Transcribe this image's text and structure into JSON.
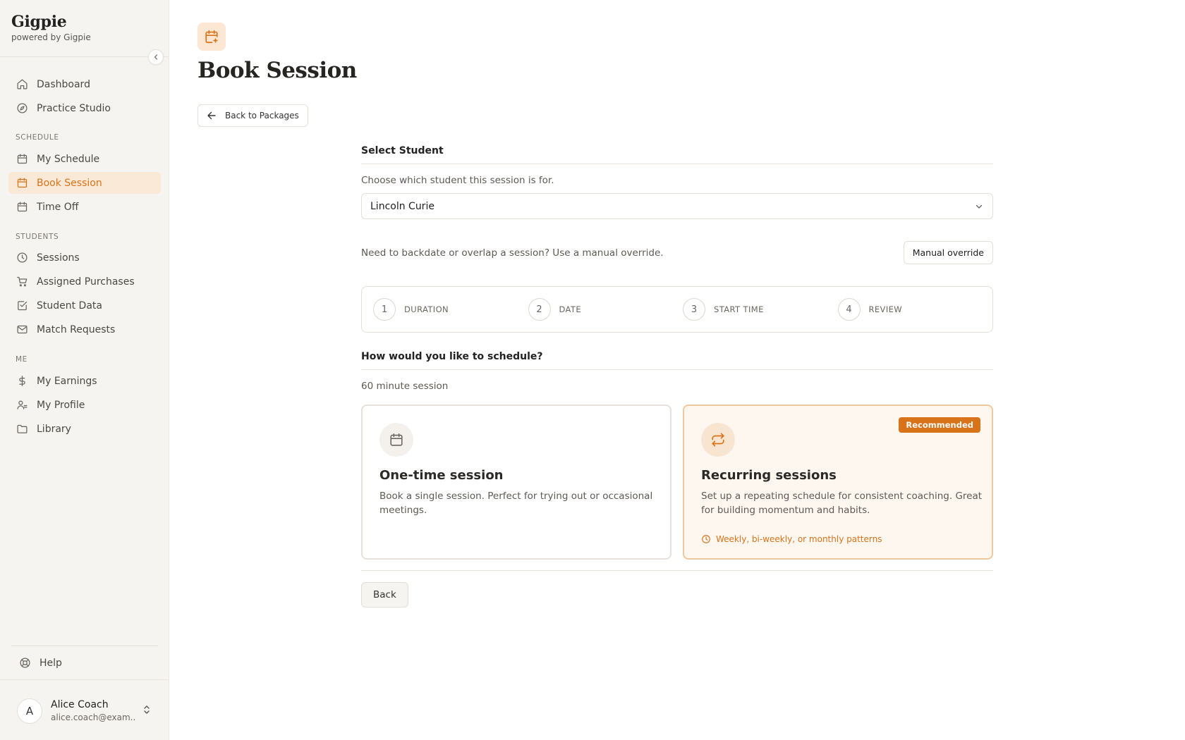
{
  "brand": {
    "name": "Gigpie",
    "subtitle": "powered by Gigpie"
  },
  "sidebar": {
    "top_items": [
      {
        "label": "Dashboard",
        "icon": "home-icon"
      },
      {
        "label": "Practice Studio",
        "icon": "compass-icon"
      }
    ],
    "sections": [
      {
        "label": "SCHEDULE",
        "items": [
          {
            "label": "My Schedule",
            "icon": "calendar-icon"
          },
          {
            "label": "Book Session",
            "icon": "calendar-plus-icon",
            "active": true
          },
          {
            "label": "Time Off",
            "icon": "calendar-icon"
          }
        ]
      },
      {
        "label": "STUDENTS",
        "items": [
          {
            "label": "Sessions",
            "icon": "clock-icon"
          },
          {
            "label": "Assigned Purchases",
            "icon": "cart-icon"
          },
          {
            "label": "Student Data",
            "icon": "checkbox-icon"
          },
          {
            "label": "Match Requests",
            "icon": "mail-icon"
          }
        ]
      },
      {
        "label": "ME",
        "items": [
          {
            "label": "My Earnings",
            "icon": "dollar-icon"
          },
          {
            "label": "My Profile",
            "icon": "user-icon"
          },
          {
            "label": "Library",
            "icon": "folder-icon"
          }
        ]
      }
    ],
    "help": {
      "label": "Help",
      "icon": "lifebuoy-icon"
    },
    "user": {
      "initial": "A",
      "name": "Alice Coach",
      "email": "alice.coach@exam..."
    }
  },
  "page": {
    "title": "Book Session",
    "back_label": "Back to Packages"
  },
  "student": {
    "title": "Select Student",
    "help": "Choose which student this session is for.",
    "selected": "Lincoln Curie"
  },
  "override": {
    "text": "Need to backdate or overlap a session? Use a manual override.",
    "button": "Manual override"
  },
  "steps": [
    {
      "num": "1",
      "label": "DURATION"
    },
    {
      "num": "2",
      "label": "DATE"
    },
    {
      "num": "3",
      "label": "START TIME"
    },
    {
      "num": "4",
      "label": "REVIEW"
    }
  ],
  "schedule": {
    "title": "How would you like to schedule?",
    "duration": "60 minute session",
    "options": [
      {
        "title": "One-time session",
        "desc": "Book a single session. Perfect for trying out or occasional meetings.",
        "icon": "calendar-icon"
      },
      {
        "title": "Recurring sessions",
        "desc": "Set up a repeating schedule for consistent coaching. Great for building momentum and habits.",
        "icon": "repeat-icon",
        "badge": "Recommended",
        "note": "Weekly, bi-weekly, or monthly patterns"
      }
    ]
  },
  "footer": {
    "back": "Back"
  },
  "colors": {
    "accent": "#d9731a",
    "accent_bg": "#fbe9d7",
    "sidebar_bg": "#f6f4f0"
  }
}
